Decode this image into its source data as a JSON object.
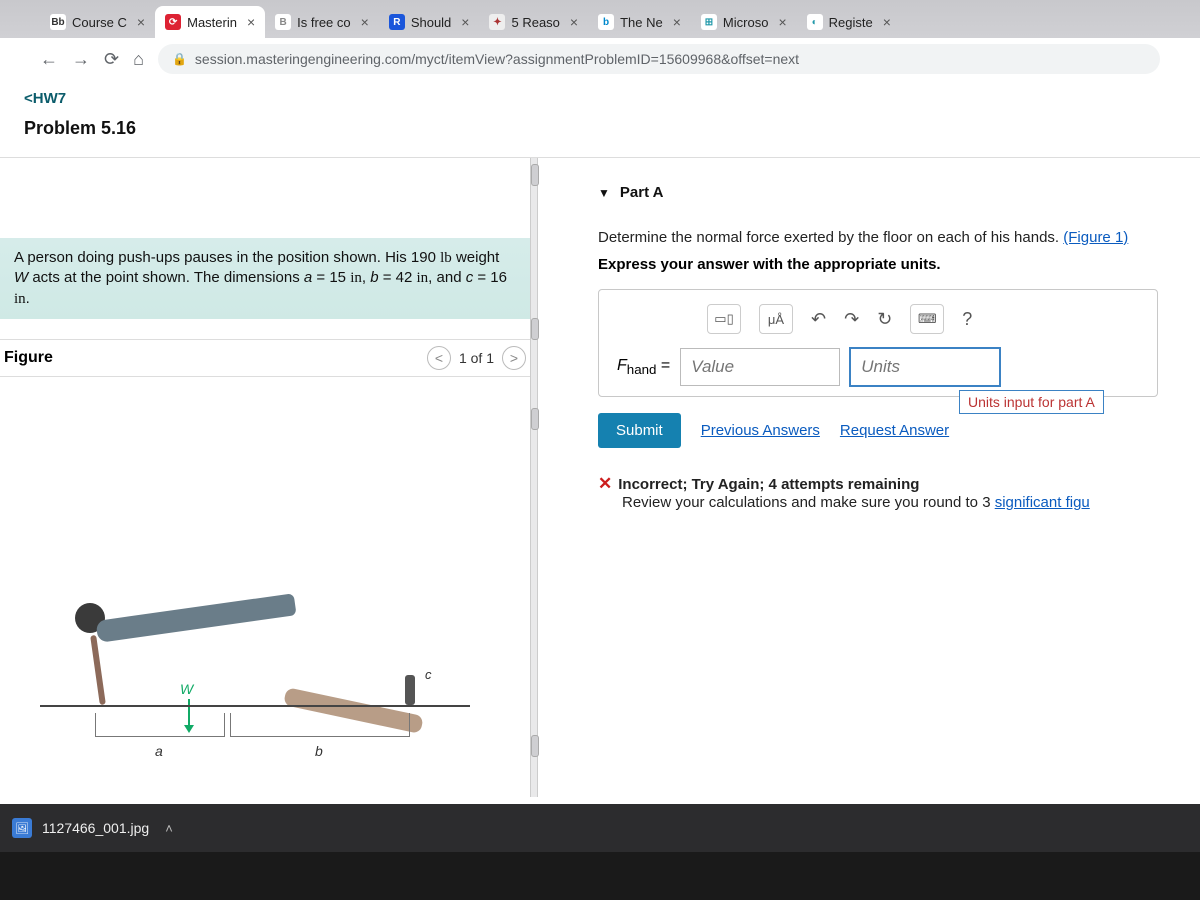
{
  "browser": {
    "tabs": [
      {
        "label": "Course C",
        "favicon_text": "Bb",
        "favicon_bg": "#ffffff",
        "favicon_fg": "#333"
      },
      {
        "label": "Masterin",
        "favicon_text": "⟳",
        "favicon_bg": "#d23",
        "favicon_fg": "#fff",
        "active": true
      },
      {
        "label": "Is free co",
        "favicon_text": "B",
        "favicon_bg": "#fff",
        "favicon_fg": "#888"
      },
      {
        "label": "Should",
        "favicon_text": "R",
        "favicon_bg": "#1a56db",
        "favicon_fg": "#fff"
      },
      {
        "label": "5 Reaso",
        "favicon_text": "✦",
        "favicon_bg": "#eee",
        "favicon_fg": "#a33"
      },
      {
        "label": "The Ne",
        "favicon_text": "b",
        "favicon_bg": "#fff",
        "favicon_fg": "#08c"
      },
      {
        "label": "Microso",
        "favicon_text": "⊞",
        "favicon_bg": "#fff",
        "favicon_fg": "#29a"
      },
      {
        "label": "Registe",
        "favicon_text": "◐",
        "favicon_bg": "#fff",
        "favicon_fg": "#29a"
      }
    ],
    "url": "session.masteringengineering.com/myct/itemView?assignmentProblemID=15609968&offset=next"
  },
  "nav": {
    "back_label": "HW7",
    "problem_title": "Problem 5.16"
  },
  "stem": {
    "text_html": "A person doing push-ups pauses in the position shown. His 190 <span style='font-family:serif'>lb</span> weight <i>W</i> acts at the point shown. The dimensions <i>a</i> = 15 <span style='font-family:serif'>in</span>, <i>b</i> = 42 <span style='font-family:serif'>in</span>, and <i>c</i> = 16 <span style='font-family:serif'>in</span>.",
    "weight_lb": 190,
    "a_in": 15,
    "b_in": 42,
    "c_in": 16
  },
  "figure": {
    "title": "Figure",
    "pager": "1 of 1",
    "labels": {
      "a": "a",
      "b": "b",
      "c": "c",
      "W": "W"
    }
  },
  "part": {
    "label": "Part A",
    "prompt": "Determine the normal force exerted by the floor on each of his hands.",
    "figure_link": "(Figure 1)",
    "instruction": "Express your answer with the appropriate units.",
    "variable_html": "<i>F</i><sub>hand</sub> =",
    "value_placeholder": "Value",
    "units_placeholder": "Units",
    "units_tooltip": "Units input for part A",
    "tool_labels": {
      "template": "▭▯",
      "symbols": "μÅ",
      "undo": "↶",
      "redo": "↷",
      "reset": "↻",
      "keyboard": "⌨",
      "help": "?"
    },
    "submit_label": "Submit",
    "prev_answers": "Previous Answers",
    "request_answer": "Request Answer"
  },
  "feedback": {
    "status": "Incorrect; Try Again; 4 attempts remaining",
    "detail_prefix": "Review your calculations and make sure you round to 3 ",
    "detail_link": "significant figu"
  },
  "download": {
    "filename": "1127466_001.jpg"
  }
}
